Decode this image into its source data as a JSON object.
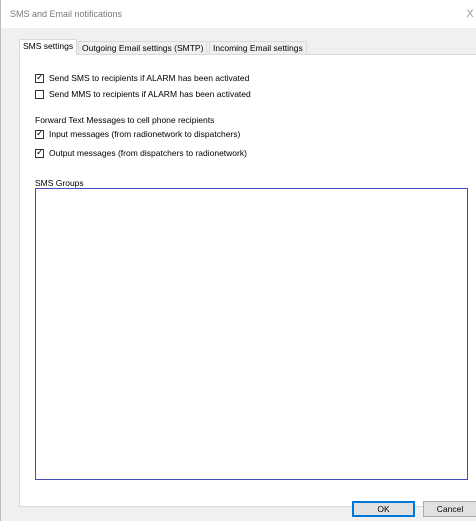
{
  "window": {
    "title": "SMS and Email notifications",
    "close_glyph": "X"
  },
  "tabs": [
    {
      "label": "SMS settings",
      "active": true
    },
    {
      "label": "Outgoing Email settings (SMTP)",
      "active": false
    },
    {
      "label": "Incoming Email settings",
      "active": false
    }
  ],
  "sms_settings": {
    "send_sms_alarm": {
      "label": "Send SMS to recipients if ALARM has been activated",
      "checked": true
    },
    "send_mms_alarm": {
      "label": "Send MMS to recipients if ALARM has been activated",
      "checked": false
    },
    "forward_heading": "Forward Text Messages to cell phone recipients",
    "input_messages": {
      "label": "Input messages (from radionetwork to dispatchers)",
      "checked": true
    },
    "output_messages": {
      "label": "Output messages (from dispatchers to radionetwork)",
      "checked": true
    },
    "sms_groups_label": "SMS Groups",
    "sms_groups_items": []
  },
  "buttons": {
    "ok": "OK",
    "cancel": "Cancel"
  },
  "check_glyph": "✓",
  "colors": {
    "listbox_border": "#4a4ac0",
    "ok_focus_border": "#0078d7"
  }
}
